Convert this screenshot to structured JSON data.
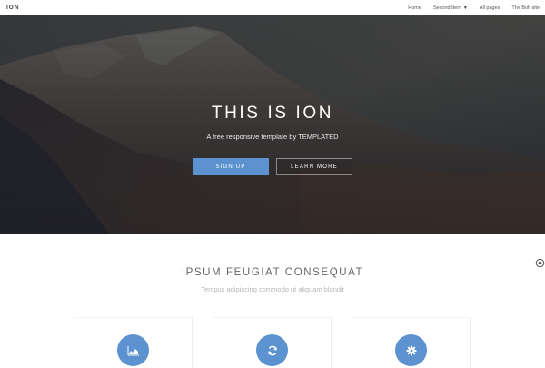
{
  "header": {
    "logo": "ION",
    "nav": [
      {
        "label": "Home"
      },
      {
        "label": "Second Item",
        "caret": "▼"
      },
      {
        "label": "All pages"
      },
      {
        "label": "The Bolt site"
      }
    ]
  },
  "hero": {
    "title": "THIS IS ION",
    "subtitle": "A free responsive template by TEMPLATED",
    "primary_button": "SIGN UP",
    "secondary_button": "LEARN MORE"
  },
  "main": {
    "title": "IPSUM FEUGIAT CONSEQUAT",
    "subtitle": "Tempus adipiscing commodo ut aliquam blandit",
    "features": [
      {
        "icon": "area-chart-icon"
      },
      {
        "icon": "refresh-icon"
      },
      {
        "icon": "gear-icon"
      }
    ]
  },
  "colors": {
    "accent": "#5b92cf",
    "hero_overlay": "#2e3036",
    "text_muted": "#b6b6b6"
  }
}
